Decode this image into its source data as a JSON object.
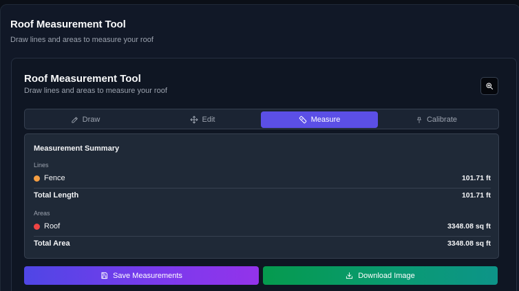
{
  "header": {
    "title": "Roof Measurement Tool",
    "subtitle": "Draw lines and areas to measure your roof"
  },
  "card": {
    "title": "Roof Measurement Tool",
    "subtitle": "Draw lines and areas to measure your roof",
    "zoom_icon": "zoom-in-icon"
  },
  "tabs": [
    {
      "label": "Draw",
      "icon": "pencil-icon",
      "active": false
    },
    {
      "label": "Edit",
      "icon": "move-icon",
      "active": false
    },
    {
      "label": "Measure",
      "icon": "ruler-icon",
      "active": true
    },
    {
      "label": "Calibrate",
      "icon": "pin-icon",
      "active": false
    }
  ],
  "summary": {
    "title": "Measurement Summary",
    "lines_label": "Lines",
    "lines": [
      {
        "name": "Fence",
        "value": "101.71 ft",
        "color": "#f59e42"
      }
    ],
    "total_length_label": "Total Length",
    "total_length_value": "101.71 ft",
    "areas_label": "Areas",
    "areas": [
      {
        "name": "Roof",
        "value": "3348.08 sq ft",
        "color": "#ef4444"
      }
    ],
    "total_area_label": "Total Area",
    "total_area_value": "3348.08 sq ft"
  },
  "buttons": {
    "save_label": "Save Measurements",
    "download_label": "Download Image"
  },
  "colors": {
    "accent": "#5b4fe6",
    "save_gradient_start": "#4f46e5",
    "save_gradient_end": "#9333ea",
    "download_gradient_start": "#059a4e",
    "download_gradient_end": "#0d9488"
  }
}
